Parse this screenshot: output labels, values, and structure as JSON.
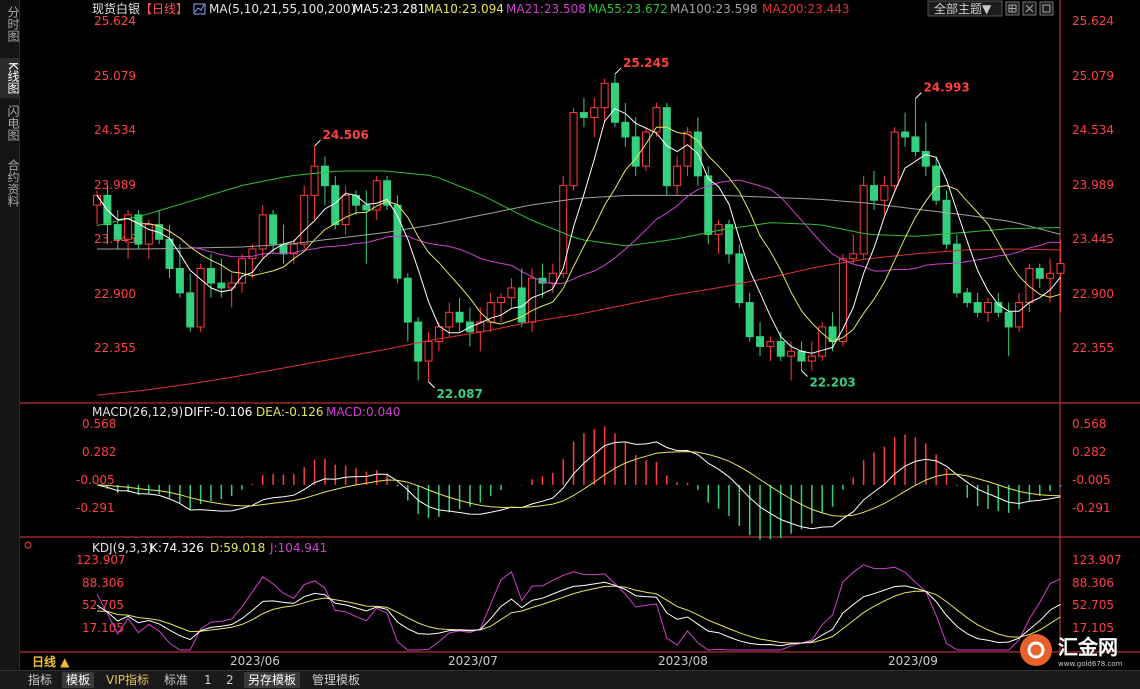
{
  "sidebar": {
    "tabs": [
      "分时图",
      "K线图",
      "闪电图",
      "合约资料"
    ],
    "active": 1
  },
  "header": {
    "instrument": "现货白银",
    "period_tag": "【日线】",
    "ma_params": "MA(5,10,21,55,100,200)",
    "ma_items": [
      {
        "label": "MA5:23.281",
        "color": "#ffffff"
      },
      {
        "label": "MA10:23.094",
        "color": "#e6e65a"
      },
      {
        "label": "MA21:23.508",
        "color": "#d040d0"
      },
      {
        "label": "MA55:23.672",
        "color": "#30c030"
      },
      {
        "label": "MA100:23.598",
        "color": "#a0a0a0"
      },
      {
        "label": "MA200:23.443",
        "color": "#e03030"
      }
    ],
    "theme_button": "全部主题▼"
  },
  "colors": {
    "up": "#ff3b3b",
    "down": "#35d07f",
    "axis": "#e03a3a",
    "grid": "#3a0f0f",
    "label_up": "#ff4040",
    "label_down": "#35d07f"
  },
  "price_axis": {
    "labels": [
      "25.624",
      "25.079",
      "24.534",
      "23.989",
      "23.445",
      "22.900",
      "22.355"
    ]
  },
  "macd_panel": {
    "title": "MACD(26,12,9)",
    "items": [
      {
        "label": "DIFF:-0.106",
        "color": "#ffffff"
      },
      {
        "label": "DEA:-0.126",
        "color": "#e6e65a"
      },
      {
        "label": "MACD:0.040",
        "color": "#d040d0"
      }
    ],
    "axis_labels": [
      "0.568",
      "0.282",
      "-0.005",
      "-0.291"
    ]
  },
  "kdj_panel": {
    "title": "KDJ(9,3,3)",
    "items": [
      {
        "label": "K:74.326",
        "color": "#ffffff"
      },
      {
        "label": "D:59.018",
        "color": "#e6e65a"
      },
      {
        "label": "J:104.941",
        "color": "#d040d0"
      }
    ],
    "axis_labels": [
      "123.907",
      "88.306",
      "52.705",
      "17.105"
    ]
  },
  "x_axis": {
    "period_selector": "日线 ▲",
    "month_labels": [
      "2023/06",
      "2023/07",
      "2023/08",
      "2023/09"
    ]
  },
  "bottom_tabs": [
    "指标",
    "模板",
    "VIP指标",
    "标准",
    "1",
    "2",
    "另存模板",
    "管理模板"
  ],
  "logo": {
    "text": "汇金网",
    "url_text": "www.gold678.com"
  },
  "chart_data": {
    "type": "candlestick",
    "price_range": [
      21.9,
      25.8
    ],
    "candles": [
      [
        23.9,
        24.05,
        23.7,
        24.0
      ],
      [
        24.0,
        24.1,
        23.5,
        23.7
      ],
      [
        23.7,
        23.85,
        23.45,
        23.55
      ],
      [
        23.55,
        23.85,
        23.35,
        23.8
      ],
      [
        23.8,
        23.85,
        23.45,
        23.5
      ],
      [
        23.5,
        23.75,
        23.35,
        23.7
      ],
      [
        23.7,
        23.85,
        23.5,
        23.55
      ],
      [
        23.55,
        23.7,
        23.15,
        23.25
      ],
      [
        23.25,
        23.5,
        22.95,
        23.0
      ],
      [
        23.0,
        23.2,
        22.6,
        22.65
      ],
      [
        22.65,
        23.3,
        22.6,
        23.25
      ],
      [
        23.25,
        23.4,
        22.95,
        23.1
      ],
      [
        23.1,
        23.35,
        22.95,
        23.05
      ],
      [
        23.05,
        23.2,
        22.85,
        23.1
      ],
      [
        23.1,
        23.4,
        23.0,
        23.35
      ],
      [
        23.35,
        23.5,
        23.15,
        23.45
      ],
      [
        23.45,
        23.9,
        23.35,
        23.8
      ],
      [
        23.8,
        23.85,
        23.4,
        23.5
      ],
      [
        23.5,
        23.7,
        23.3,
        23.4
      ],
      [
        23.4,
        23.55,
        23.3,
        23.5
      ],
      [
        23.5,
        24.1,
        23.45,
        24.0
      ],
      [
        24.0,
        24.506,
        23.75,
        24.3
      ],
      [
        24.3,
        24.4,
        23.9,
        24.1
      ],
      [
        24.1,
        24.2,
        23.65,
        23.7
      ],
      [
        23.7,
        24.1,
        23.6,
        24.0
      ],
      [
        24.0,
        24.05,
        23.8,
        23.9
      ],
      [
        23.9,
        24.05,
        23.3,
        23.85
      ],
      [
        23.85,
        24.2,
        23.75,
        24.15
      ],
      [
        24.15,
        24.2,
        23.85,
        23.9
      ],
      [
        23.9,
        24.0,
        23.1,
        23.15
      ],
      [
        23.15,
        23.2,
        22.5,
        22.7
      ],
      [
        22.7,
        22.75,
        22.1,
        22.3
      ],
      [
        22.3,
        22.6,
        22.087,
        22.5
      ],
      [
        22.5,
        22.7,
        22.4,
        22.65
      ],
      [
        22.65,
        22.9,
        22.55,
        22.8
      ],
      [
        22.8,
        22.95,
        22.6,
        22.7
      ],
      [
        22.7,
        22.85,
        22.45,
        22.6
      ],
      [
        22.6,
        22.85,
        22.4,
        22.7
      ],
      [
        22.7,
        23.0,
        22.6,
        22.9
      ],
      [
        22.9,
        23.0,
        22.7,
        22.95
      ],
      [
        22.95,
        23.15,
        22.85,
        23.05
      ],
      [
        23.05,
        23.25,
        22.65,
        22.7
      ],
      [
        22.7,
        23.25,
        22.6,
        23.15
      ],
      [
        23.15,
        23.3,
        22.95,
        23.1
      ],
      [
        23.1,
        23.3,
        23.0,
        23.2
      ],
      [
        23.2,
        24.2,
        23.15,
        24.1
      ],
      [
        24.1,
        24.9,
        24.05,
        24.85
      ],
      [
        24.85,
        25.0,
        24.7,
        24.8
      ],
      [
        24.8,
        25.0,
        24.6,
        24.9
      ],
      [
        24.9,
        25.2,
        24.75,
        25.15
      ],
      [
        25.15,
        25.245,
        24.7,
        24.75
      ],
      [
        24.75,
        24.95,
        24.5,
        24.6
      ],
      [
        24.6,
        24.8,
        24.2,
        24.3
      ],
      [
        24.3,
        24.7,
        24.25,
        24.65
      ],
      [
        24.65,
        24.95,
        24.6,
        24.9
      ],
      [
        24.9,
        24.95,
        24.0,
        24.1
      ],
      [
        24.1,
        24.4,
        24.0,
        24.3
      ],
      [
        24.3,
        24.7,
        24.2,
        24.65
      ],
      [
        24.65,
        24.8,
        24.1,
        24.2
      ],
      [
        24.2,
        24.3,
        23.5,
        23.6
      ],
      [
        23.6,
        23.75,
        23.4,
        23.7
      ],
      [
        23.7,
        23.75,
        23.3,
        23.4
      ],
      [
        23.4,
        23.5,
        22.85,
        22.9
      ],
      [
        22.9,
        23.0,
        22.5,
        22.55
      ],
      [
        22.55,
        22.7,
        22.35,
        22.45
      ],
      [
        22.45,
        22.55,
        22.3,
        22.5
      ],
      [
        22.5,
        22.6,
        22.3,
        22.35
      ],
      [
        22.35,
        22.5,
        22.1,
        22.4
      ],
      [
        22.4,
        22.5,
        22.203,
        22.3
      ],
      [
        22.3,
        22.5,
        22.2,
        22.35
      ],
      [
        22.35,
        22.7,
        22.3,
        22.65
      ],
      [
        22.65,
        22.8,
        22.4,
        22.5
      ],
      [
        22.5,
        23.4,
        22.45,
        23.35
      ],
      [
        23.35,
        23.6,
        23.3,
        23.4
      ],
      [
        23.4,
        24.2,
        23.35,
        24.1
      ],
      [
        24.1,
        24.25,
        23.85,
        23.95
      ],
      [
        23.95,
        24.2,
        23.8,
        24.1
      ],
      [
        24.1,
        24.7,
        24.05,
        24.65
      ],
      [
        24.65,
        24.85,
        24.5,
        24.6
      ],
      [
        24.6,
        24.993,
        24.4,
        24.45
      ],
      [
        24.45,
        24.75,
        24.2,
        24.3
      ],
      [
        24.3,
        24.4,
        23.9,
        23.95
      ],
      [
        23.95,
        24.05,
        23.45,
        23.5
      ],
      [
        23.5,
        23.6,
        22.95,
        23.0
      ],
      [
        23.0,
        23.05,
        22.85,
        22.9
      ],
      [
        22.9,
        23.0,
        22.75,
        22.8
      ],
      [
        22.8,
        22.95,
        22.7,
        22.9
      ],
      [
        22.9,
        23.0,
        22.75,
        22.8
      ],
      [
        22.8,
        22.9,
        22.35,
        22.65
      ],
      [
        22.65,
        23.0,
        22.6,
        22.9
      ],
      [
        22.9,
        23.3,
        22.8,
        23.25
      ],
      [
        23.25,
        23.3,
        23.05,
        23.15
      ],
      [
        23.15,
        23.35,
        22.9,
        23.2
      ],
      [
        23.2,
        23.55,
        22.8,
        23.3
      ]
    ],
    "price_labels": [
      {
        "text": "24.506",
        "index": 21,
        "kind": "high"
      },
      {
        "text": "22.087",
        "index": 32,
        "kind": "low"
      },
      {
        "text": "25.245",
        "index": 50,
        "kind": "high"
      },
      {
        "text": "22.203",
        "index": 68,
        "kind": "low"
      },
      {
        "text": "24.993",
        "index": 79,
        "kind": "high"
      }
    ],
    "moving_averages": [
      {
        "name": "MA5",
        "color": "#ffffff"
      },
      {
        "name": "MA10",
        "color": "#e6e65a"
      },
      {
        "name": "MA21",
        "color": "#d040d0"
      },
      {
        "name": "MA55",
        "color": "#30c030"
      },
      {
        "name": "MA100",
        "color": "#a0a0a0"
      },
      {
        "name": "MA200",
        "color": "#e03030"
      }
    ],
    "ma55_values": [
      23.69,
      23.8,
      23.95,
      24.1,
      24.2,
      24.25,
      24.25,
      24.2,
      24.0,
      23.75,
      23.55,
      23.48,
      23.55,
      23.65,
      23.72,
      23.7,
      23.6,
      23.58,
      23.62,
      23.66,
      23.67
    ],
    "ma100_values": [
      23.45,
      23.45,
      23.46,
      23.47,
      23.5,
      23.56,
      23.62,
      23.7,
      23.8,
      23.9,
      23.97,
      24.0,
      24.0,
      24.0,
      23.98,
      23.96,
      23.92,
      23.86,
      23.8,
      23.73,
      23.6
    ],
    "ma200_values": [
      21.95,
      22.0,
      22.07,
      22.15,
      22.24,
      22.33,
      22.42,
      22.52,
      22.6,
      22.7,
      22.78,
      22.88,
      22.98,
      23.06,
      23.16,
      23.27,
      23.35,
      23.4,
      23.44,
      23.45,
      23.44
    ],
    "macd_range": [
      -0.45,
      0.62
    ],
    "kdj_range": [
      0,
      130
    ]
  }
}
